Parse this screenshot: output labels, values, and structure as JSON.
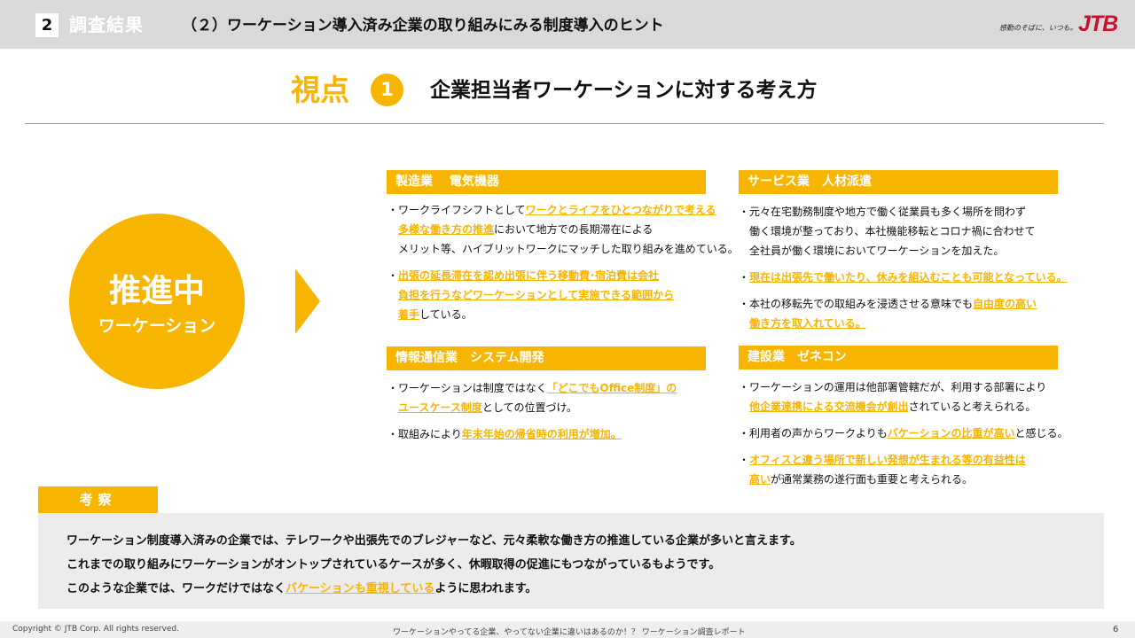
{
  "header": {
    "section_number": "2",
    "section_title": "調査結果",
    "subtitle": "（２）ワーケーション導入済み企業の取り組みにみる制度導入のヒント",
    "logo_tagline": "感動のそばに、いつも。",
    "logo": "JTB"
  },
  "viewpoint": {
    "label": "視点",
    "number": "1",
    "heading": "企業担当者ワーケーションに対する考え方"
  },
  "status_circle": {
    "main": "推進中",
    "sub": "ワーケーション"
  },
  "cards": {
    "manufacturing": {
      "title": "製造業　 電気機器",
      "paragraphs": [
        [
          [
            "・ワークライフシフトとして",
            ""
          ],
          [
            "ワークとライフをひとつながりで考える",
            "hl"
          ]
        ],
        [
          [
            "　",
            ""
          ],
          [
            "多様な働き方の推進",
            "hl"
          ],
          [
            "において地方での長期滞在による",
            ""
          ]
        ],
        [
          [
            "　メリット等、ハイブリットワークにマッチした取り組みを進めている。",
            ""
          ]
        ],
        [
          [
            "・",
            ""
          ],
          [
            "出張の延長滞在を認め出張に伴う移動費･宿泊費は会社",
            "hl"
          ]
        ],
        [
          [
            "　",
            ""
          ],
          [
            "負担を行うなどワーケーションとして実施できる範囲から",
            "hl"
          ]
        ],
        [
          [
            "　",
            ""
          ],
          [
            "着手",
            "hl"
          ],
          [
            "している。",
            ""
          ]
        ]
      ]
    },
    "ict": {
      "title": "情報通信業　システム開発",
      "paragraphs": [
        [
          [
            "・ワーケーションは制度ではなく",
            ""
          ],
          [
            "「どこでもOffice制度」の",
            "hl"
          ]
        ],
        [
          [
            "　",
            ""
          ],
          [
            "ユースケース制度",
            "hl"
          ],
          [
            "としての位置づけ。",
            ""
          ]
        ],
        [
          [
            "・取組みにより",
            ""
          ],
          [
            "年末年始の帰省時の利用が増加。",
            "hl"
          ]
        ]
      ]
    },
    "service": {
      "title": "サービス業　人材派遣",
      "paragraphs": [
        [
          [
            "・元々在宅勤務制度や地方で働く従業員も多く場所を問わず",
            ""
          ]
        ],
        [
          [
            "　働く環境が整っており、本社機能移転とコロナ禍に合わせて",
            ""
          ]
        ],
        [
          [
            "　全社員が働く環境においてワーケーションを加えた。",
            ""
          ]
        ],
        [
          [
            "・",
            ""
          ],
          [
            "現在は出張先で働いたり、休みを組込むことも可能となっている。",
            "hl"
          ]
        ],
        [
          [
            "・本社の移転先での取組みを浸透させる意味でも",
            ""
          ],
          [
            "自由度の高い",
            "hl"
          ]
        ],
        [
          [
            "　",
            ""
          ],
          [
            "働き方を取入れている。",
            "hl"
          ]
        ]
      ]
    },
    "construction": {
      "title": "建設業　ゼネコン",
      "paragraphs": [
        [
          [
            "・ワーケーションの運用は他部署管轄だが、利用する部署により",
            ""
          ]
        ],
        [
          [
            "　",
            ""
          ],
          [
            "他企業連携による交流機会が創出",
            "hl"
          ],
          [
            "されていると考えられる。",
            ""
          ]
        ],
        [
          [
            "・利用者の声からワークよりも",
            ""
          ],
          [
            "バケーションの比重が高い",
            "hl"
          ],
          [
            "と感じる。",
            ""
          ]
        ],
        [
          [
            "・",
            ""
          ],
          [
            "オフィスと違う場所で新しい発想が生まれる等の有益性は",
            "hl"
          ]
        ],
        [
          [
            "　",
            ""
          ],
          [
            "高い",
            "hl"
          ],
          [
            "が通常業務の遂行面も重要と考えられる。",
            ""
          ]
        ]
      ]
    }
  },
  "kosatsu": {
    "label": "考察",
    "lines": [
      [
        [
          "ワーケーション制度導入済みの企業では、テレワークや出張先でのブレジャーなど、元々柔軟な働き方の推進している企業が多いと言えます。",
          ""
        ]
      ],
      [
        [
          "これまでの取り組みにワーケーションがオントップされているケースが多く、休暇取得の促進にもつながっているもようです。",
          ""
        ]
      ],
      [
        [
          "このような企業では、ワークだけではなく",
          ""
        ],
        [
          "バケーションも重視している",
          "hl"
        ],
        [
          "ように思われます。",
          ""
        ]
      ]
    ]
  },
  "footer": {
    "copyright": "Copyright © JTB Corp. All rights reserved.",
    "center": "ワーケーションやってる企業、やってない企業に違いはあるのか！？ ワーケーション調査レポート",
    "page": "6"
  },
  "colors": {
    "accent": "#f8b500",
    "header_bg": "#d9d9d9",
    "logo_red": "#c8102e"
  }
}
